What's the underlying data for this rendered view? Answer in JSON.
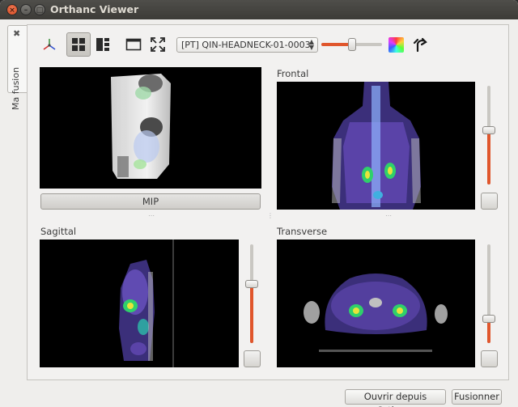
{
  "window": {
    "title": "Orthanc Viewer"
  },
  "tab": {
    "label": "Ma fusion"
  },
  "toolbar": {
    "series_selected": "[PT] QIN-HEADNECK-01-0003",
    "opacity_level": 0.5
  },
  "views": {
    "mip_button": "MIP",
    "frontal_label": "Frontal",
    "sagittal_label": "Sagittal",
    "transverse_label": "Transverse",
    "frontal_slice": 0.55,
    "sagittal_slice": 0.6,
    "transverse_slice": 0.25
  },
  "footer": {
    "open_button": "Ouvrir depuis Orthanc",
    "fuse_button": "Fusionner"
  },
  "colors": {
    "accent": "#e0562c",
    "titlebar": "#3c3b37"
  },
  "icons": [
    "close-icon",
    "minimize-icon",
    "maximize-icon",
    "axes-icon",
    "grid-layout-icon",
    "split-layout-icon",
    "window-icon",
    "fullscreen-icon",
    "colormap-icon",
    "rotate-icon"
  ]
}
